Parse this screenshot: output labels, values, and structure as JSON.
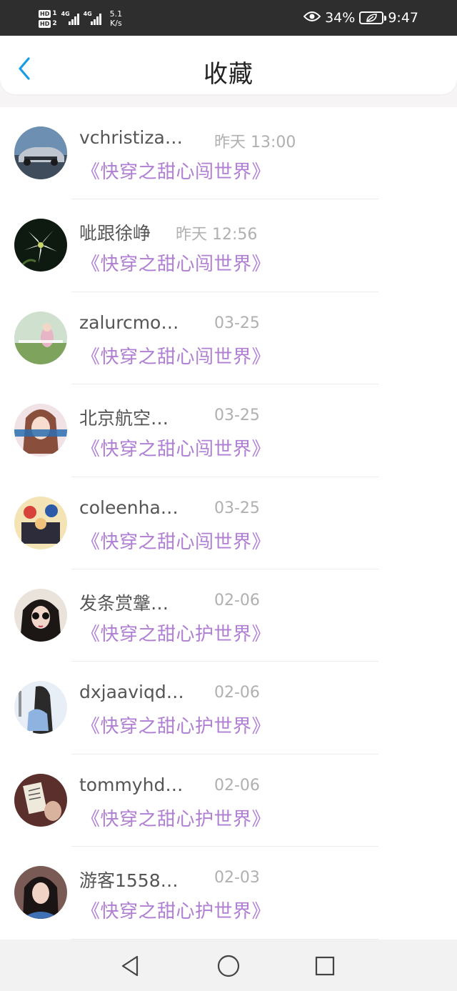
{
  "status_bar": {
    "hd1": "HD",
    "sim1": "1",
    "hd2": "HD",
    "sim2": "2",
    "net1": "4G",
    "net2": "4G",
    "speed_value": "5.1",
    "speed_unit": "K/s",
    "battery": "34%",
    "time": "9:47"
  },
  "header": {
    "title": "收藏"
  },
  "favorites": [
    {
      "name": "vchristiza…",
      "time": "昨天 13:00",
      "book": "《快穿之甜心闯世界》"
    },
    {
      "name": "呲跟徐峥",
      "time": "昨天 12:56",
      "book": "《快穿之甜心闯世界》"
    },
    {
      "name": "zalurcmo…",
      "time": "03-25",
      "book": "《快穿之甜心闯世界》"
    },
    {
      "name": "北京航空…",
      "time": "03-25",
      "book": "《快穿之甜心闯世界》"
    },
    {
      "name": "coleenha…",
      "time": "03-25",
      "book": "《快穿之甜心闯世界》"
    },
    {
      "name": "发条赏鞶…",
      "time": "02-06",
      "book": "《快穿之甜心护世界》"
    },
    {
      "name": "dxjaaviqd…",
      "time": "02-06",
      "book": "《快穿之甜心护世界》"
    },
    {
      "name": "tommyhd…",
      "time": "02-06",
      "book": "《快穿之甜心护世界》"
    },
    {
      "name": "游客1558…",
      "time": "02-03",
      "book": "《快穿之甜心护世界》"
    }
  ],
  "colors": {
    "accent": "#1a9be8",
    "book_title": "#b07fd4",
    "time": "#b0b0b0"
  }
}
